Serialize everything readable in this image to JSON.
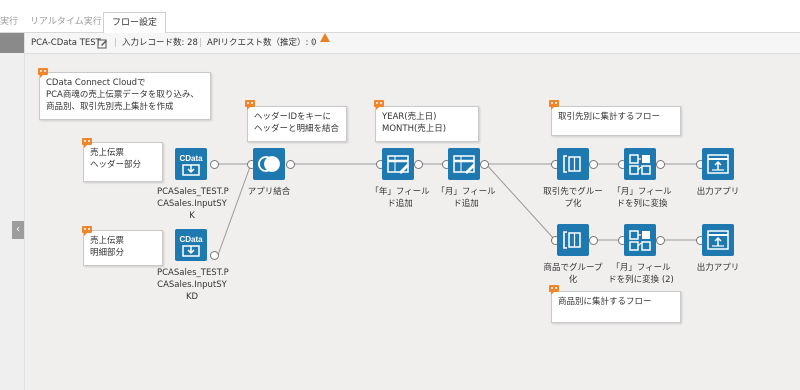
{
  "topbar": {
    "tabs": [
      {
        "label": "実行",
        "active": false
      },
      {
        "label": "リアルタイム実行",
        "active": false
      },
      {
        "label": "フロー設定",
        "active": true
      }
    ]
  },
  "infobar": {
    "project_name": "PCA-CData TEST",
    "input_records": "入力レコード数: 28",
    "api_requests": "APIリクエスト数（推定）: 0"
  },
  "notes": {
    "intro": "CData Connect Cloudで\nPCA商魂の売上伝票データを取り込み、\n商品別、取引先別売上集計を作成",
    "header_source": "売上伝票\nヘッダー部分",
    "detail_source": "売上伝票\n明細部分",
    "join_note": "ヘッダーIDをキーに\nヘッダーと明細を結合",
    "date_note": "YEAR(売上日)\nMONTH(売上日)",
    "by_customer": "取引先別に集計するフロー",
    "by_product": "商品別に集計するフロー"
  },
  "nodes": {
    "src1": {
      "icon": "cdata-icon",
      "label": "PCASales_TEST.P\nCASales.InputSY\nK",
      "icon_text": "CData"
    },
    "src2": {
      "icon": "cdata-icon",
      "label": "PCASales_TEST.P\nCASales.InputSY\nKD",
      "icon_text": "CData"
    },
    "join": {
      "icon": "join-icon",
      "label": "アプリ結合"
    },
    "year": {
      "icon": "field-add-icon",
      "label": "「年」フィール\nド追加"
    },
    "month": {
      "icon": "field-add-icon",
      "label": "「月」フィール\nド追加"
    },
    "group1": {
      "icon": "group-icon",
      "label": "取引先でグルー\nプ化"
    },
    "pivot1": {
      "icon": "pivot-icon",
      "label": "「月」フィール\nドを列に変換"
    },
    "out1": {
      "icon": "output-icon",
      "label": "出力アプリ"
    },
    "group2": {
      "icon": "group-icon",
      "label": "商品でグループ\n化"
    },
    "pivot2": {
      "icon": "pivot-icon",
      "label": "「月」フィール\nドを列に変換 (2)"
    },
    "out2": {
      "icon": "output-icon",
      "label": "出力アプリ"
    }
  },
  "colors": {
    "node": "#1e79b0",
    "note_icon": "#f0862b",
    "canvas": "#f1eeee"
  }
}
